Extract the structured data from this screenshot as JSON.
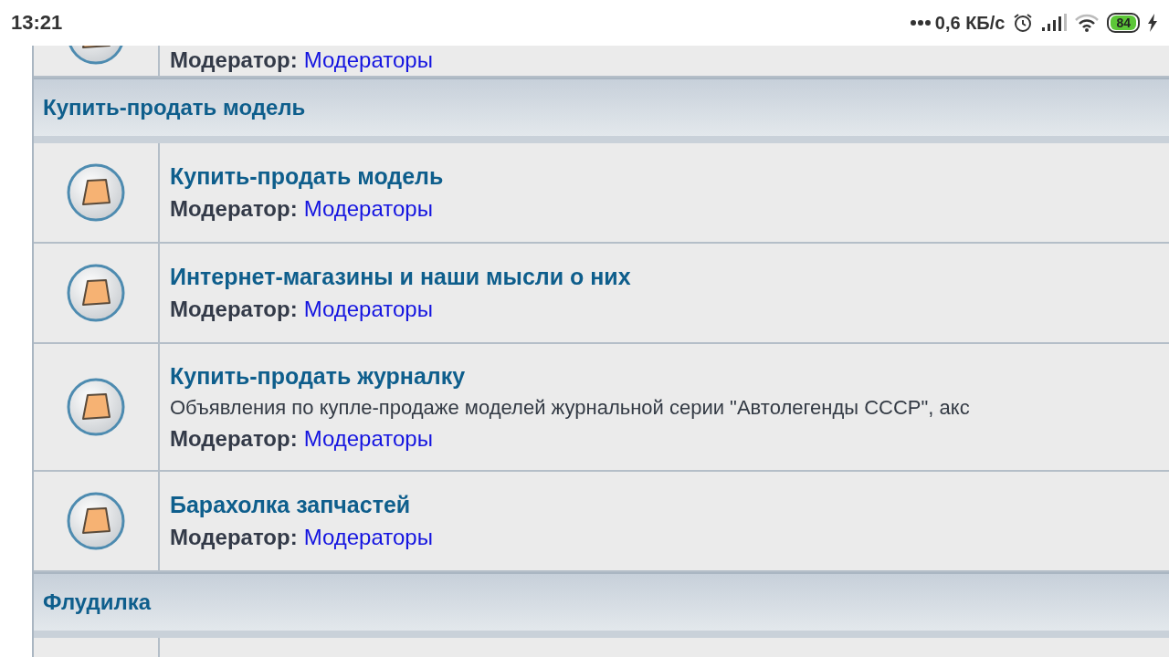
{
  "status_bar": {
    "time": "13:21",
    "network_speed": "0,6 КБ/с",
    "battery": "84",
    "charging": true
  },
  "rows": [
    {
      "kind": "forum",
      "moderator_label": "Модератор:",
      "moderator_link": "Модераторы"
    },
    {
      "kind": "category",
      "title": "Купить-продать модель"
    },
    {
      "kind": "forum",
      "title": "Купить-продать модель",
      "moderator_label": "Модератор:",
      "moderator_link": "Модераторы"
    },
    {
      "kind": "forum",
      "title": "Интернет-магазины и наши мысли о них",
      "moderator_label": "Модератор:",
      "moderator_link": "Модераторы"
    },
    {
      "kind": "forum",
      "title": "Купить-продать журналку",
      "description": "Объявления по купле-продаже моделей журнальной серии \"Автолегенды СССР\", акс",
      "moderator_label": "Модератор:",
      "moderator_link": "Модераторы"
    },
    {
      "kind": "forum",
      "title": "Барахолка запчастей",
      "moderator_label": "Модератор:",
      "moderator_link": "Модераторы"
    },
    {
      "kind": "category",
      "title": "Флудилка"
    },
    {
      "kind": "forum"
    }
  ]
}
